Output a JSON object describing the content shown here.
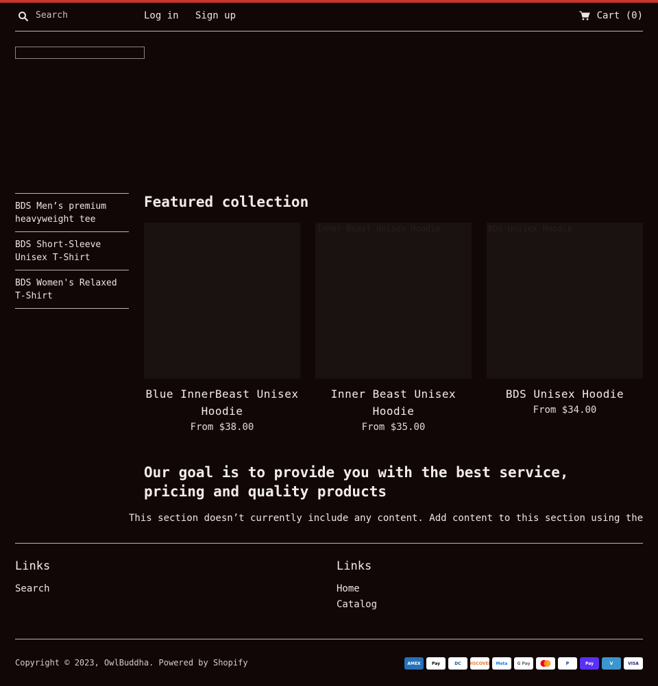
{
  "colors": {
    "background": "#110707",
    "accent_bar": "#c8352b",
    "text": "#ece6e2",
    "rule": "#bdb6b2",
    "image_placeholder": "#1a1111"
  },
  "header": {
    "search_placeholder": "Search",
    "search_icon": "search-icon",
    "login": "Log in",
    "signup": "Sign up",
    "cart_label": "Cart (0)",
    "cart_icon": "cart-icon"
  },
  "sidebar": {
    "items": [
      {
        "label": "BDS Men’s premium heavyweight tee"
      },
      {
        "label": "BDS Short-Sleeve Unisex T-Shirt"
      },
      {
        "label": "BDS Women's Relaxed T-Shirt"
      }
    ]
  },
  "featured": {
    "title": "Featured collection",
    "products": [
      {
        "name": "Blue InnerBeast Unisex Hoodie",
        "price": "From $38.00",
        "alt": ""
      },
      {
        "name": "Inner Beast Unisex Hoodie",
        "price": "From $35.00",
        "alt": "Inner Beast Unisex Hoodie"
      },
      {
        "name": "BDS Unisex Hoodie",
        "price": "From $34.00",
        "alt": "BDS Unisex Hoodie"
      }
    ]
  },
  "goal": {
    "heading": "Our goal is to provide you with the best service, pricing and quality products",
    "empty_note": "This section doesn’t currently include any content. Add content to this section using the"
  },
  "footer": {
    "col1": {
      "heading": "Links",
      "links": [
        "Search"
      ]
    },
    "col2": {
      "heading": "Links",
      "links": [
        "Home",
        "Catalog"
      ]
    },
    "copyright": "Copyright © 2023, OwlBuddha. Powered by Shopify",
    "payments": [
      {
        "label": "AMEX",
        "icon": "amex-icon",
        "bg": "#2671b9",
        "fg": "#ffffff"
      },
      {
        "label": "Pay",
        "icon": "apple-pay-icon",
        "bg": "#ffffff",
        "fg": "#000000"
      },
      {
        "label": "DC",
        "icon": "diners-club-icon",
        "bg": "#ffffff",
        "fg": "#0a5296"
      },
      {
        "label": "DISCOVER",
        "icon": "discover-icon",
        "bg": "#ffffff",
        "fg": "#e6772e"
      },
      {
        "label": "Meta",
        "icon": "meta-pay-icon",
        "bg": "#ffffff",
        "fg": "#1877f2"
      },
      {
        "label": "G Pay",
        "icon": "google-pay-icon",
        "bg": "#ffffff",
        "fg": "#5f6368"
      },
      {
        "label": "",
        "icon": "mastercard-icon",
        "bg": "#ffffff",
        "fg": "#eb001b"
      },
      {
        "label": "P",
        "icon": "paypal-icon",
        "bg": "#ffffff",
        "fg": "#003087"
      },
      {
        "label": "Pay",
        "icon": "shop-pay-icon",
        "bg": "#5a31f4",
        "fg": "#ffffff"
      },
      {
        "label": "V",
        "icon": "venmo-icon",
        "bg": "#3d95ce",
        "fg": "#ffffff"
      },
      {
        "label": "VISA",
        "icon": "visa-icon",
        "bg": "#ffffff",
        "fg": "#1a1f71"
      }
    ]
  }
}
